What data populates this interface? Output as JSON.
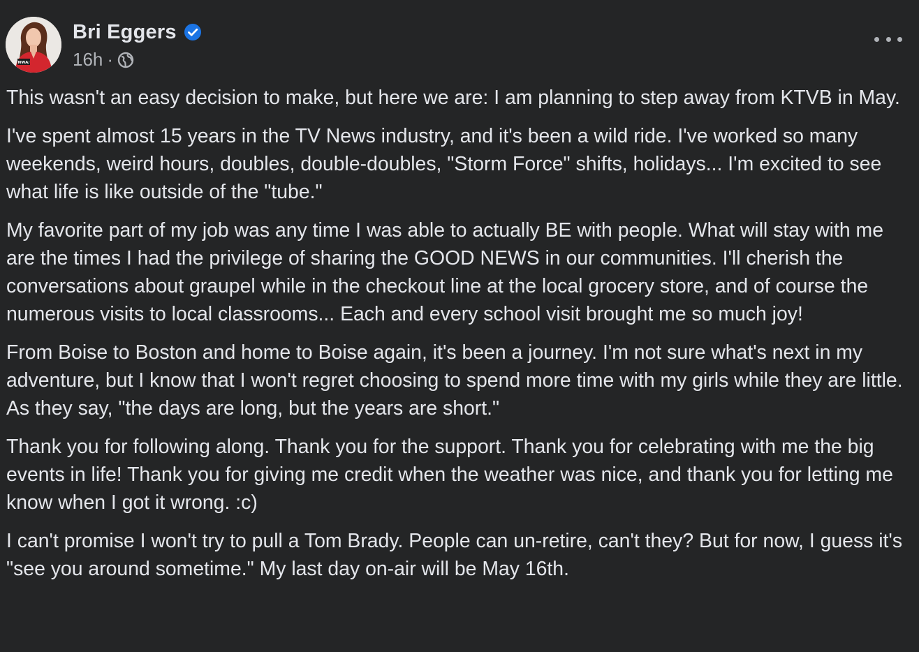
{
  "post": {
    "author": {
      "name": "Bri Eggers",
      "verified_icon": "verified-badge-icon",
      "avatar_badge": "NWA/"
    },
    "meta": {
      "time": "16h",
      "separator": "·",
      "audience_icon": "globe-icon"
    },
    "menu_icon": "more-options-icon",
    "paragraphs": [
      "This wasn't an easy decision to make, but here we are:  I am planning to step away from KTVB in May.",
      "I've spent almost 15 years in the TV News industry, and it's been a wild ride.  I've worked so many weekends, weird hours, doubles, double-doubles, \"Storm Force\" shifts, holidays...  I'm excited to see what life is like outside of the \"tube.\"",
      "My favorite part of my job was any time I was able to actually BE with people.  What will stay with me are the times I had the privilege of sharing the GOOD NEWS in our communities.  I'll cherish the conversations about graupel while in the checkout line at the local grocery store, and of course the numerous visits to local classrooms...  Each and every school visit brought me so much joy!",
      "From Boise to Boston and home to Boise again, it's been a journey.  I'm not sure what's next in my adventure, but I know that I won't regret choosing to spend more time with my girls while they are little.  As they say, \"the days are long, but the years are short.\"",
      "Thank you for following along.  Thank you for the support.  Thank you for celebrating with me the big events in life!  Thank you for giving me credit when the weather was nice, and thank you for letting me know when I got it wrong. :c)",
      "I can't promise I won't try to pull a Tom Brady.  People can un-retire, can't they?  But for now, I guess it's \"see you around sometime.\"  My last day on-air will be May 16th."
    ]
  },
  "colors": {
    "background": "#242526",
    "primary_text": "#e4e6eb",
    "secondary_text": "#b0b3b8",
    "verified_blue": "#1b74e4",
    "avatar_red": "#d3262e"
  }
}
